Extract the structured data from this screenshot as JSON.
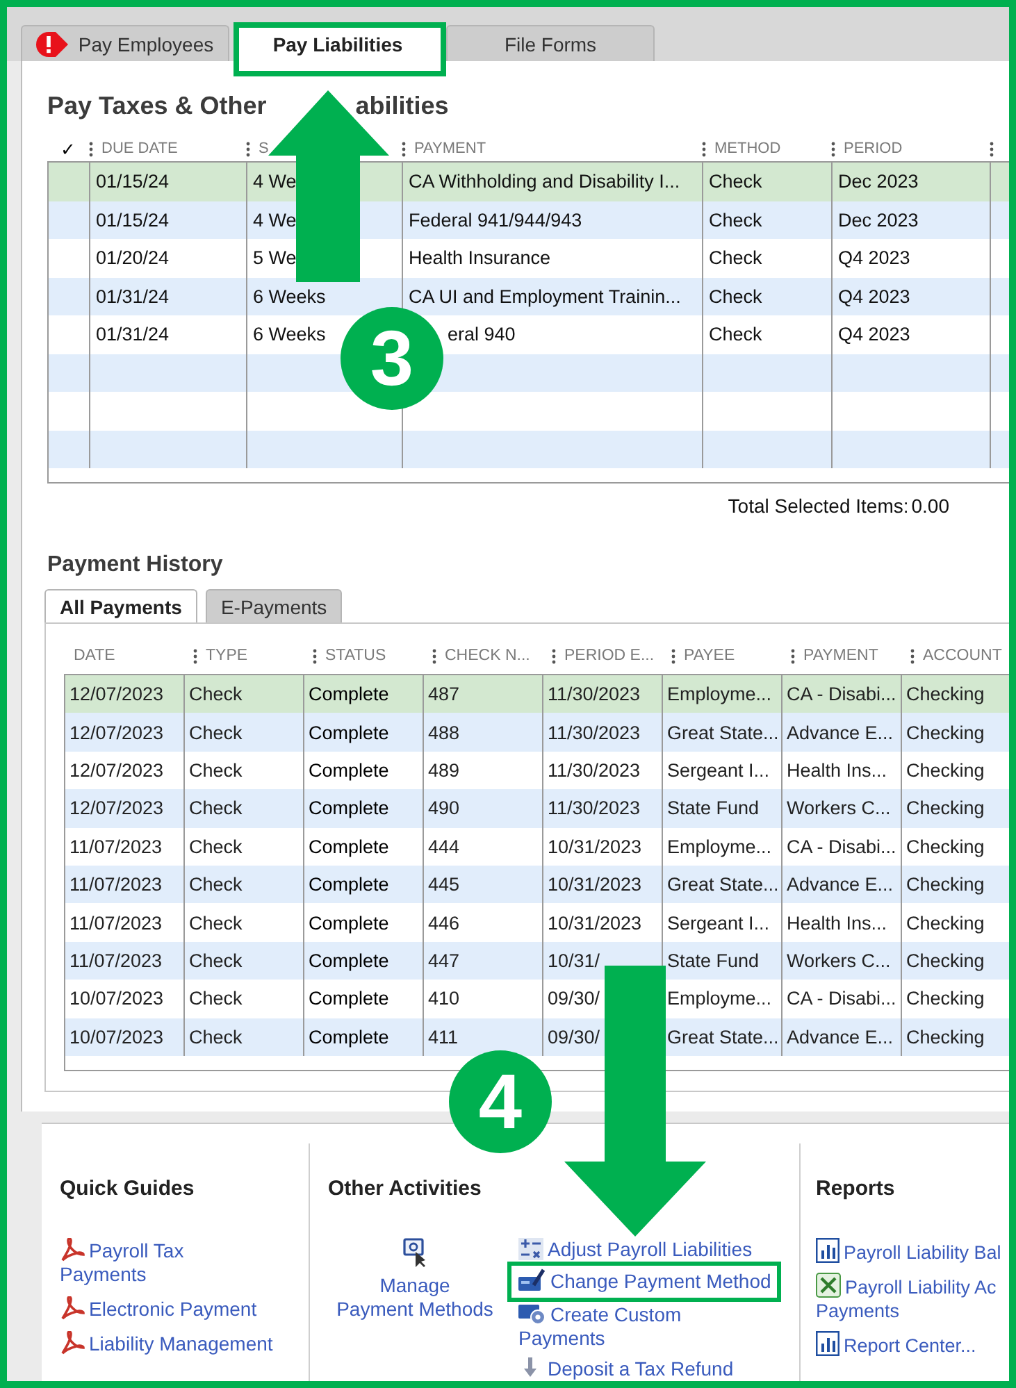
{
  "tabs": [
    {
      "label": "Pay Employees",
      "selected": false,
      "alert": true,
      "highlighted": false
    },
    {
      "label": "Pay Liabilities",
      "selected": true,
      "alert": false,
      "highlighted": true
    },
    {
      "label": "File Forms",
      "selected": false,
      "alert": false,
      "highlighted": false
    }
  ],
  "liabilities": {
    "title": [
      "Pay Taxes & Other",
      "abilities"
    ],
    "columns": [
      "✓",
      "DUE DATE",
      "S",
      "PAYMENT",
      "METHOD",
      "PERIOD"
    ],
    "rows": [
      {
        "selected": true,
        "due_date": "01/15/24",
        "status": "4 We",
        "payment": "CA Withholding and Disability I...",
        "method": "Check",
        "period": "Dec 2023"
      },
      {
        "selected": false,
        "due_date": "01/15/24",
        "status": "4 We",
        "payment": "Federal 941/944/943",
        "method": "Check",
        "period": "Dec 2023"
      },
      {
        "selected": false,
        "due_date": "01/20/24",
        "status": "5 We",
        "payment": "Health Insurance",
        "method": "Check",
        "period": "Q4 2023"
      },
      {
        "selected": false,
        "due_date": "01/31/24",
        "status": "6 Weeks",
        "payment": "CA UI and Employment Trainin...",
        "method": "Check",
        "period": "Q4 2023"
      },
      {
        "selected": false,
        "due_date": "01/31/24",
        "status": "6 Weeks",
        "payment": "eral 940",
        "method": "Check",
        "period": "Q4 2023"
      }
    ],
    "total_selected": {
      "label": "Total Selected Items:",
      "value": "0.00"
    }
  },
  "history": {
    "title": "Payment History",
    "tabs": [
      {
        "label": "All Payments",
        "selected": true
      },
      {
        "label": "E-Payments",
        "selected": false
      }
    ],
    "columns": [
      "DATE",
      "TYPE",
      "STATUS",
      "CHECK N...",
      "PERIOD E...",
      "PAYEE",
      "PAYMENT",
      "ACCOUNT"
    ],
    "rows": [
      {
        "selected": true,
        "cells": [
          "12/07/2023",
          "Check",
          "Complete",
          "487",
          "11/30/2023",
          "Employme...",
          "CA - Disabi...",
          "Checking"
        ]
      },
      {
        "selected": false,
        "cells": [
          "12/07/2023",
          "Check",
          "Complete",
          "488",
          "11/30/2023",
          "Great State...",
          "Advance E...",
          "Checking"
        ]
      },
      {
        "selected": false,
        "cells": [
          "12/07/2023",
          "Check",
          "Complete",
          "489",
          "11/30/2023",
          "Sergeant I...",
          "Health Ins...",
          "Checking"
        ]
      },
      {
        "selected": false,
        "cells": [
          "12/07/2023",
          "Check",
          "Complete",
          "490",
          "11/30/2023",
          "State Fund",
          "Workers C...",
          "Checking"
        ]
      },
      {
        "selected": false,
        "cells": [
          "11/07/2023",
          "Check",
          "Complete",
          "444",
          "10/31/2023",
          "Employme...",
          "CA - Disabi...",
          "Checking"
        ]
      },
      {
        "selected": false,
        "cells": [
          "11/07/2023",
          "Check",
          "Complete",
          "445",
          "10/31/2023",
          "Great State...",
          "Advance E...",
          "Checking"
        ]
      },
      {
        "selected": false,
        "cells": [
          "11/07/2023",
          "Check",
          "Complete",
          "446",
          "10/31/2023",
          "Sergeant I...",
          "Health Ins...",
          "Checking"
        ]
      },
      {
        "selected": false,
        "cells": [
          "11/07/2023",
          "Check",
          "Complete",
          "447",
          "10/31/",
          "State Fund",
          "Workers C...",
          "Checking"
        ]
      },
      {
        "selected": false,
        "cells": [
          "10/07/2023",
          "Check",
          "Complete",
          "410",
          "09/30/",
          "Employme...",
          "CA - Disabi...",
          "Checking"
        ]
      },
      {
        "selected": false,
        "cells": [
          "10/07/2023",
          "Check",
          "Complete",
          "411",
          "09/30/",
          "Great State...",
          "Advance E...",
          "Checking"
        ]
      }
    ]
  },
  "callouts": [
    {
      "number": "3"
    },
    {
      "number": "4"
    }
  ],
  "quick_guides": {
    "title": "Quick Guides",
    "links": [
      {
        "lines": [
          "Payroll Tax",
          "Payments"
        ]
      },
      {
        "lines": [
          "Electronic Payment"
        ]
      },
      {
        "lines": [
          "Liability Management"
        ]
      }
    ]
  },
  "other_activities": {
    "title": "Other Activities",
    "manage": {
      "lines": [
        "Manage",
        "Payment Methods"
      ]
    },
    "links": [
      {
        "lines": [
          "Adjust Payroll Liabilities"
        ],
        "highlighted": false
      },
      {
        "lines": [
          "Change Payment Method"
        ],
        "highlighted": true
      },
      {
        "lines": [
          "Create Custom",
          "Payments"
        ],
        "highlighted": false
      },
      {
        "lines": [
          "Deposit a Tax Refund"
        ],
        "highlighted": false
      }
    ]
  },
  "reports": {
    "title": "Reports",
    "links": [
      {
        "lines": [
          "Payroll Liability Bal"
        ]
      },
      {
        "lines": [
          "Payroll Liability Ac",
          "Payments"
        ]
      },
      {
        "lines": [
          "Report Center..."
        ]
      }
    ]
  }
}
